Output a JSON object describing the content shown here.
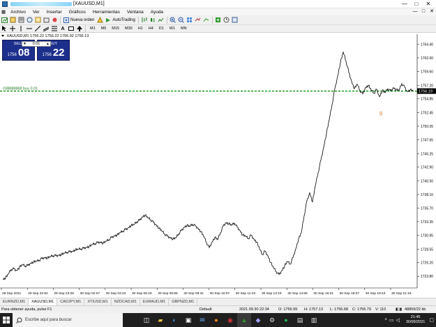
{
  "window": {
    "title": "[XAUUSD,M1]",
    "controls": [
      "—",
      "□",
      "✕"
    ]
  },
  "menu": {
    "items": [
      "Archivo",
      "Ver",
      "Insertar",
      "Gráficos",
      "Herramientas",
      "Ventana",
      "Ayuda"
    ],
    "window_controls": [
      "—",
      "□",
      "✕"
    ]
  },
  "toolbar": {
    "new_order_label": "Nueva orden",
    "autotrading_label": "AutoTrading"
  },
  "timeframes": [
    "M1",
    "M5",
    "M15",
    "M30",
    "H1",
    "H4",
    "D1",
    "W1",
    "MN"
  ],
  "chart": {
    "info": "XAUUSD,M1 1756.22 1756.22 1756.92 1756.13",
    "trade_panel": {
      "sell_label": "SELL",
      "buy_label": "BUY",
      "lot": "0.01",
      "sell_price_small": "1756",
      "sell_price_big": "08",
      "buy_price_small": "1756",
      "buy_price_big": "22"
    },
    "line_label": "#38888888 buy 0.01",
    "current_price": "1756.19",
    "line_color": "#1a9a1a",
    "marker": "g"
  },
  "chart_data": {
    "type": "line",
    "title": "XAUUSD,M1",
    "y_ticks": [
      "1764.40",
      "1762.00",
      "1759.60",
      "1757.20",
      "1754.85",
      "1752.45",
      "1750.05",
      "1747.65",
      "1745.25",
      "1742.90",
      "1740.50",
      "1738.10",
      "1735.70",
      "1733.35",
      "1730.95",
      "1728.55",
      "1726.20",
      "1723.80"
    ],
    "ylim": [
      1722.0,
      1765.9
    ],
    "x_ticks": [
      "29 Sep 2021",
      "29 Sep 22:52",
      "29 Sep 23:28",
      "30 Sep 02:07",
      "30 Sep 03:43",
      "30 Sep 05:19",
      "30 Sep 06:55",
      "30 Sep 08:31",
      "30 Sep 10:07",
      "30 Sep 11:43",
      "30 Sep 13:19",
      "30 Sep 14:59",
      "30 Sep 16:31",
      "30 Sep 18:07",
      "30 Sep 19:43",
      "30 Sep 21:19"
    ],
    "x": [
      0,
      4,
      8,
      12,
      16,
      20,
      24,
      28,
      32,
      36,
      40,
      44,
      48,
      52,
      56,
      60,
      64,
      68,
      72,
      76,
      80,
      84,
      88,
      92,
      96,
      100,
      104,
      108,
      112,
      116,
      120,
      124,
      128,
      132,
      136,
      140,
      144,
      148,
      152,
      156,
      160,
      164,
      168,
      172,
      176,
      180,
      184,
      188,
      192,
      196,
      200,
      204,
      208,
      212,
      216,
      220,
      224,
      228,
      232,
      236,
      240,
      244,
      248,
      252,
      256,
      260,
      264,
      268,
      272,
      276,
      280,
      284,
      288,
      292,
      296,
      300,
      304,
      308,
      312,
      316,
      320,
      324,
      328,
      332,
      336,
      340,
      344,
      348,
      352,
      356,
      360,
      364,
      368,
      372,
      376,
      380,
      384,
      388,
      392,
      396,
      400,
      404,
      408,
      412,
      416,
      420,
      424,
      428,
      432,
      436,
      440,
      444,
      448,
      452,
      456,
      460,
      464,
      468,
      472,
      476,
      480,
      484,
      488,
      492,
      496,
      500,
      504,
      508,
      512,
      516,
      520,
      524,
      528,
      532,
      536,
      540,
      544,
      548,
      552,
      556,
      560,
      564,
      568,
      572,
      576,
      580,
      584,
      588,
      592
    ],
    "values": [
      1723.3,
      1723.5,
      1724.2,
      1725.0,
      1725.1,
      1724.8,
      1725.4,
      1725.8,
      1725.6,
      1725.7,
      1726.1,
      1726.3,
      1726.4,
      1726.6,
      1726.9,
      1727.1,
      1727.0,
      1727.2,
      1727.4,
      1727.4,
      1727.5,
      1727.6,
      1727.8,
      1728.0,
      1728.1,
      1728.2,
      1728.4,
      1728.5,
      1728.6,
      1728.7,
      1728.9,
      1729.0,
      1729.3,
      1729.5,
      1729.7,
      1729.8,
      1729.6,
      1729.9,
      1730.2,
      1730.6,
      1730.9,
      1731.0,
      1731.4,
      1731.7,
      1732.0,
      1732.3,
      1732.7,
      1732.8,
      1733.3,
      1733.6,
      1734.2,
      1734.5,
      1734.0,
      1733.7,
      1733.2,
      1732.8,
      1732.2,
      1731.7,
      1731.2,
      1730.8,
      1730.6,
      1730.3,
      1730.5,
      1731.2,
      1731.8,
      1732.4,
      1732.7,
      1732.5,
      1732.9,
      1732.6,
      1732.2,
      1731.6,
      1730.8,
      1729.7,
      1728.8,
      1729.8,
      1730.6,
      1730.2,
      1731.4,
      1732.6,
      1733.2,
      1733.0,
      1732.7,
      1733.1,
      1732.4,
      1731.8,
      1731.0,
      1730.8,
      1730.4,
      1731.0,
      1730.3,
      1729.8,
      1728.6,
      1727.6,
      1728.2,
      1727.4,
      1726.2,
      1725.3,
      1724.6,
      1724.1,
      1724.8,
      1725.6,
      1726.4,
      1725.9,
      1727.1,
      1728.6,
      1730.3,
      1731.4,
      1734.4,
      1737.0,
      1738.4,
      1736.8,
      1739.6,
      1741.9,
      1744.1,
      1746.4,
      1748.8,
      1751.2,
      1753.8,
      1756.6,
      1758.8,
      1761.2,
      1763.0,
      1761.4,
      1759.5,
      1757.9,
      1756.6,
      1757.4,
      1756.3,
      1755.7,
      1756.8,
      1757.2,
      1756.4,
      1755.8,
      1756.5,
      1755.2,
      1756.3,
      1755.9,
      1756.6,
      1756.2,
      1756.8,
      1756.4,
      1756.3,
      1757.5,
      1756.9,
      1756.1,
      1756.4,
      1756.2
    ],
    "grid": false
  },
  "symbol_tabs": [
    "EURNZD,M1",
    "XAUUSD,M1",
    "CADJPY,M1",
    "XTIUSD,M1",
    "NZDCAD,M1",
    "EURAUD,M1",
    "GBPNZD,M1"
  ],
  "status": {
    "help": "Para obtener ayuda, pulse F1",
    "profile": "Default",
    "datetime": "2021.09.30 22:34",
    "open": "O: 1756.99",
    "high": "H: 1757.13",
    "low": "L: 1756.68",
    "close": "C: 1756.79",
    "volume": "V: 110",
    "traffic": "48809/22 kb"
  },
  "taskbar": {
    "search_placeholder": "Escribe aquí para buscar",
    "time": "21:45",
    "date": "30/09/2021"
  }
}
